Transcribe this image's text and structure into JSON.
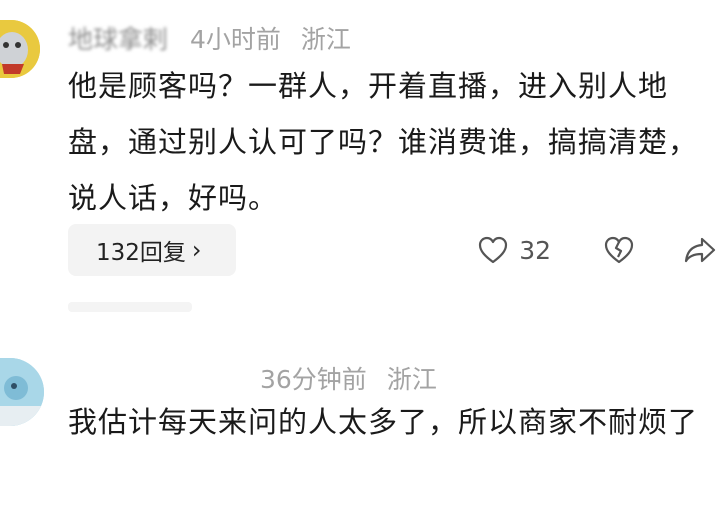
{
  "comments": [
    {
      "username": "地球拿剌",
      "time": "4小时前",
      "region": "浙江",
      "text": "他是顾客吗？一群人，开着直播，进入别人地盘，通过别人认可了吗？谁消费谁，搞搞清楚，说人话，好吗。",
      "reply_label": "132回复",
      "like_count": "32"
    },
    {
      "username": "",
      "time": "36分钟前",
      "region": "浙江",
      "text": "我估计每天来问的人太多了，所以商家不耐烦了"
    }
  ],
  "icons": {
    "like": "heart-outline-icon",
    "dislike": "broken-heart-icon",
    "share": "share-arrow-icon",
    "reply_chevron": "chevron-right-icon"
  }
}
